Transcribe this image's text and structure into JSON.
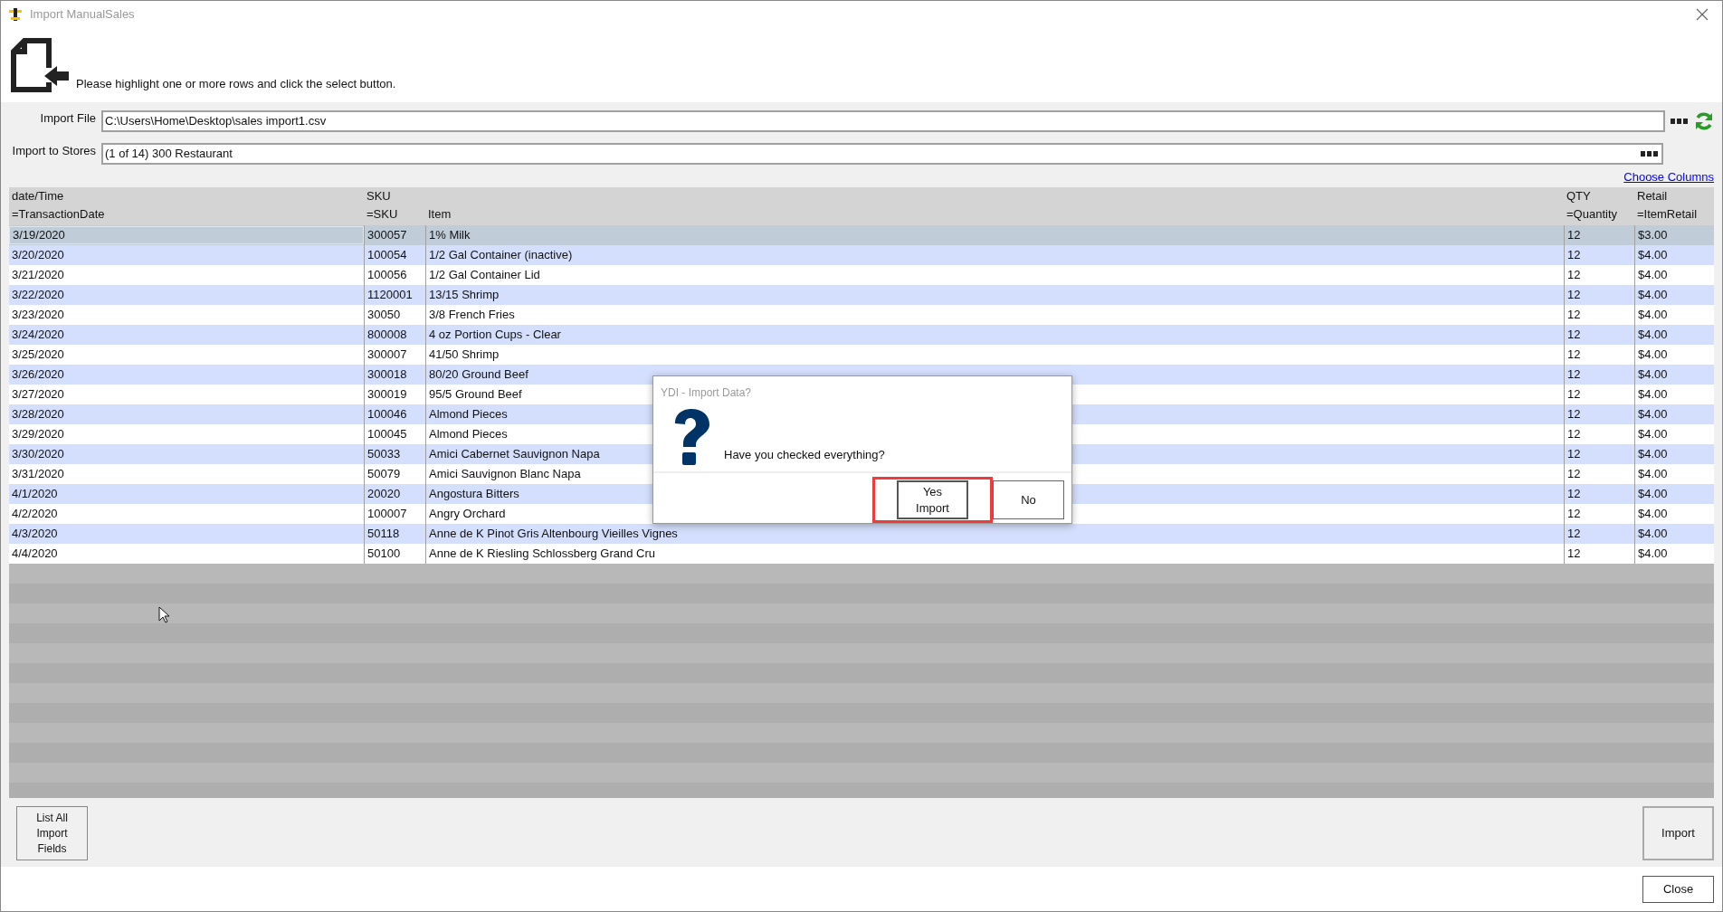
{
  "window": {
    "title": "Import ManualSales"
  },
  "instruction": "Please highlight one or more rows and click the select button.",
  "import_file": {
    "label": "Import File",
    "value": "C:\\Users\\Home\\Desktop\\sales import1.csv"
  },
  "import_to_stores": {
    "label": "Import to Stores",
    "value": "(1 of 14) 300 Restaurant"
  },
  "choose_columns_link": "Choose Columns",
  "table": {
    "columns": [
      {
        "line1": "date/Time",
        "line2": "=TransactionDate"
      },
      {
        "line1": "SKU",
        "line2": "=SKU"
      },
      {
        "line2": "Item"
      },
      {
        "line1": "QTY",
        "line2": "=Quantity"
      },
      {
        "line1": "Retail",
        "line2": "=ItemRetail"
      }
    ],
    "rows": [
      {
        "cells": [
          "3/19/2020",
          "300057",
          "1% Milk",
          "12",
          "$3.00"
        ],
        "selected": true
      },
      {
        "cells": [
          "3/20/2020",
          "100054",
          "1/2 Gal Container (inactive)",
          "12",
          "$4.00"
        ],
        "selected": false
      },
      {
        "cells": [
          "3/21/2020",
          "100056",
          "1/2 Gal Container Lid",
          "12",
          "$4.00"
        ],
        "selected": false
      },
      {
        "cells": [
          "3/22/2020",
          "1120001",
          "13/15 Shrimp",
          "12",
          "$4.00"
        ],
        "selected": false
      },
      {
        "cells": [
          "3/23/2020",
          "30050",
          "3/8 French Fries",
          "12",
          "$4.00"
        ],
        "selected": false
      },
      {
        "cells": [
          "3/24/2020",
          "800008",
          "4 oz Portion Cups - Clear",
          "12",
          "$4.00"
        ],
        "selected": false
      },
      {
        "cells": [
          "3/25/2020",
          "300007",
          "41/50 Shrimp",
          "12",
          "$4.00"
        ],
        "selected": false
      },
      {
        "cells": [
          "3/26/2020",
          "300018",
          "80/20 Ground Beef",
          "12",
          "$4.00"
        ],
        "selected": false
      },
      {
        "cells": [
          "3/27/2020",
          "300019",
          "95/5 Ground Beef",
          "12",
          "$4.00"
        ],
        "selected": false
      },
      {
        "cells": [
          "3/28/2020",
          "100046",
          "Almond Pieces",
          "12",
          "$4.00"
        ],
        "selected": false
      },
      {
        "cells": [
          "3/29/2020",
          "100045",
          "Almond Pieces",
          "12",
          "$4.00"
        ],
        "selected": false
      },
      {
        "cells": [
          "3/30/2020",
          "50033",
          "Amici Cabernet Sauvignon Napa",
          "12",
          "$4.00"
        ],
        "selected": false
      },
      {
        "cells": [
          "3/31/2020",
          "50079",
          "Amici Sauvignon Blanc Napa",
          "12",
          "$4.00"
        ],
        "selected": false
      },
      {
        "cells": [
          "4/1/2020",
          "20020",
          "Angostura Bitters",
          "12",
          "$4.00"
        ],
        "selected": false
      },
      {
        "cells": [
          "4/2/2020",
          "100007",
          "Angry Orchard",
          "12",
          "$4.00"
        ],
        "selected": false
      },
      {
        "cells": [
          "4/3/2020",
          "50118",
          "Anne de K Pinot Gris Altenbourg Vieilles Vignes",
          "12",
          "$4.00"
        ],
        "selected": false
      },
      {
        "cells": [
          "4/4/2020",
          "50100",
          "Anne de K Riesling Schlossberg Grand Cru",
          "12",
          "$4.00"
        ],
        "selected": false
      }
    ]
  },
  "list_fields_button": "List All Import Fields",
  "import_button": "Import",
  "close_button": "Close",
  "dialog": {
    "title": "YDI - Import Data?",
    "message": "Have you checked everything?",
    "buttons": [
      {
        "label": "Yes Import",
        "highlighted": true
      },
      {
        "label": "No",
        "highlighted": false
      }
    ]
  }
}
